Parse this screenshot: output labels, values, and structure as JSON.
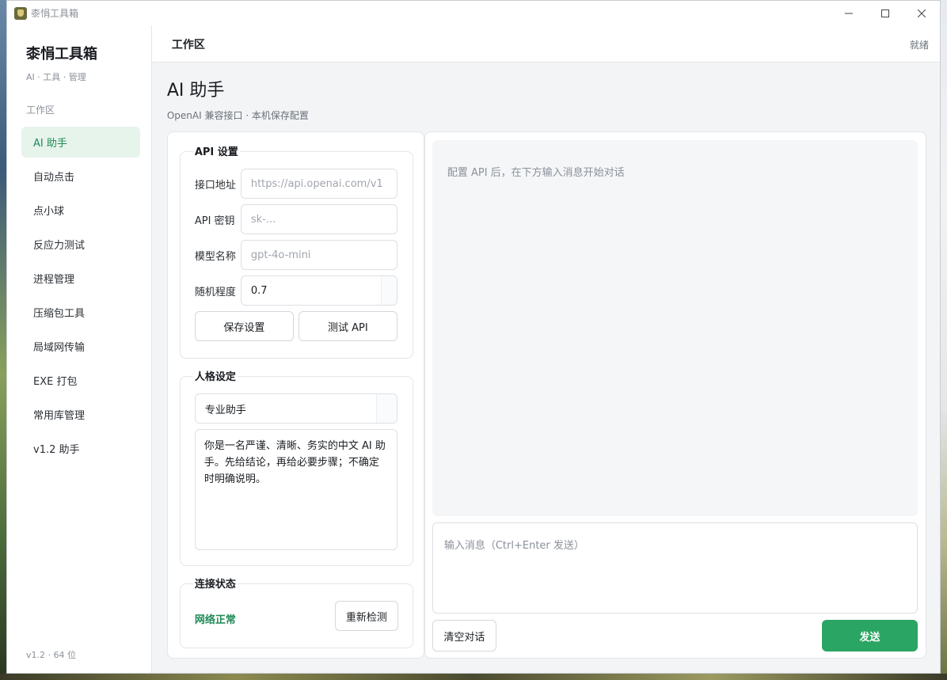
{
  "window": {
    "title": "桼悁工具箱"
  },
  "sidebar": {
    "brand": "桼悁工具箱",
    "tagline": "AI · 工具 · 管理",
    "section": "工作区",
    "items": [
      {
        "label": "AI 助手",
        "active": true
      },
      {
        "label": "自动点击"
      },
      {
        "label": "点小球"
      },
      {
        "label": "反应力测试"
      },
      {
        "label": "进程管理"
      },
      {
        "label": "压缩包工具"
      },
      {
        "label": "局域网传输"
      },
      {
        "label": "EXE 打包"
      },
      {
        "label": "常用库管理"
      },
      {
        "label": "v1.2 助手"
      }
    ],
    "version": "v1.2 · 64 位"
  },
  "topbar": {
    "title": "工作区",
    "status": "就绪"
  },
  "page": {
    "title": "AI 助手",
    "subtitle": "OpenAI 兼容接口 · 本机保存配置"
  },
  "api_settings": {
    "title": "API 设置",
    "endpoint_label": "接口地址",
    "endpoint_placeholder": "https://api.openai.com/v1",
    "key_label": "API 密钥",
    "key_placeholder": "sk-...",
    "model_label": "模型名称",
    "model_placeholder": "gpt-4o-mini",
    "temperature_label": "随机程度",
    "temperature_value": "0.7",
    "save_label": "保存设置",
    "test_label": "测试 API"
  },
  "persona": {
    "title": "人格设定",
    "selected": "专业助手",
    "prompt": "你是一名严谨、清晰、务实的中文 AI 助手。先给结论，再给必要步骤；不确定时明确说明。"
  },
  "connection": {
    "title": "连接状态",
    "status": "网络正常",
    "status_color": "#1e8a55",
    "recheck_label": "重新检测"
  },
  "chat": {
    "hint": "配置 API 后，在下方输入消息开始对话",
    "input_placeholder": "输入消息（Ctrl+Enter 发送）",
    "clear_label": "清空对话",
    "send_label": "发送",
    "accent_color": "#2aa563"
  }
}
